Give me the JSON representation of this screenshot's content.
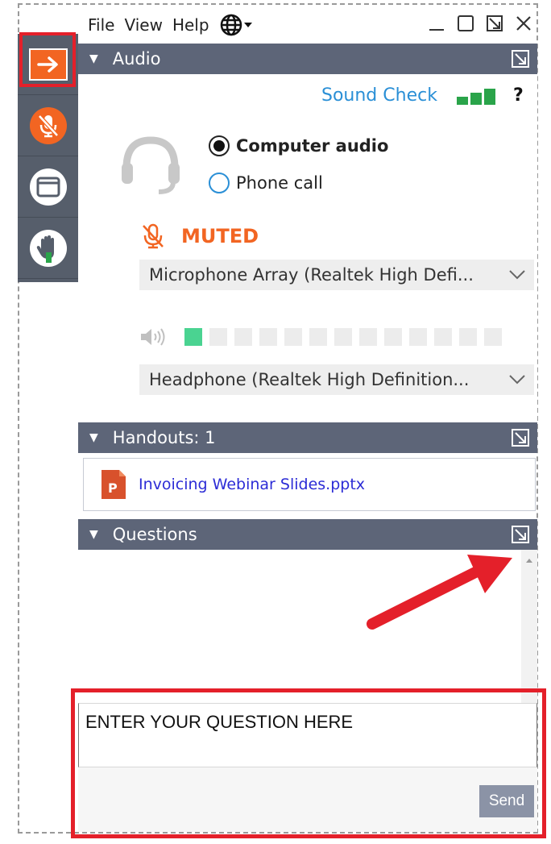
{
  "menubar": {
    "items": [
      "File",
      "View",
      "Help"
    ],
    "language_icon": "globe-icon"
  },
  "window_controls": [
    "minimize-icon",
    "restore-icon",
    "popout-icon",
    "close-icon"
  ],
  "left_toolbar": {
    "buttons": [
      "collapse-arrow-icon",
      "microphone-muted-icon",
      "screen-icon",
      "raise-hand-icon"
    ]
  },
  "audio": {
    "header": "Audio",
    "sound_check": "Sound Check",
    "help": "?",
    "options": [
      {
        "label": "Computer audio",
        "selected": true
      },
      {
        "label": "Phone call",
        "selected": false
      }
    ],
    "status": "MUTED",
    "microphone": "Microphone Array (Realtek High Defi...",
    "speaker": "Headphone (Realtek High Definition...",
    "level_segments_total": 13,
    "level_segments_on": 1
  },
  "handouts": {
    "header": "Handouts: 1",
    "files": [
      {
        "name": "Invoicing Webinar Slides.pptx",
        "icon": "pptx-file-icon"
      }
    ]
  },
  "questions": {
    "header": "Questions",
    "input_value": "ENTER YOUR QUESTION HERE",
    "send_label": "Send"
  },
  "colors": {
    "header_bg": "#5d6578",
    "accent_orange": "#f26522",
    "link_blue": "#2a8fd6",
    "annotation_red": "#e4202a",
    "level_green": "#4ad391"
  }
}
